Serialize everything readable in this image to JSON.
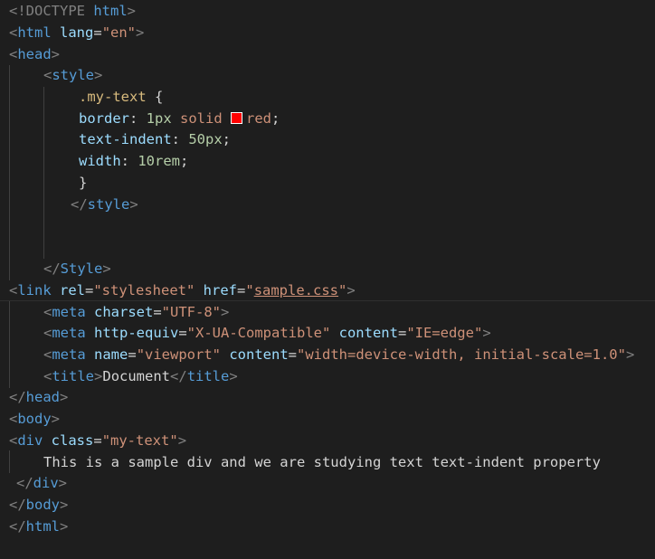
{
  "editor": {
    "theme_background": "#1e1e1e",
    "lines": {
      "l1": {
        "doctype_open": "<!DOCTYPE",
        "doctype_word": " html",
        "close": ">"
      },
      "l2": {
        "open": "<",
        "tag": "html",
        "attr": " lang",
        "eq": "=",
        "val": "\"en\"",
        "close": ">"
      },
      "l3": {
        "open": "<",
        "tag": "head",
        "close": ">"
      },
      "l4": {
        "open": "<",
        "tag": "style",
        "close": ">"
      },
      "l5": {
        "selector": ".my-text",
        "brace": " {"
      },
      "l6": {
        "prop": "border",
        "colon": ": ",
        "num": "1px",
        "val1": " solid ",
        "color": "red",
        "semi": ";",
        "swatch_color": "#ff0000"
      },
      "l7": {
        "prop": "text-indent",
        "colon": ": ",
        "num": "50px",
        "semi": ";"
      },
      "l8": {
        "prop": "width",
        "colon": ": ",
        "num": "10rem",
        "semi": ";"
      },
      "l9": {
        "brace": "}"
      },
      "l10": {
        "open": "</",
        "tag": "style",
        "close": ">"
      },
      "l13": {
        "open": "</",
        "tag": "Style",
        "close": ">"
      },
      "l14": {
        "open": "<",
        "tag": "link",
        "attr1": " rel",
        "eq": "=",
        "val1": "\"stylesheet\"",
        "attr2": " href",
        "val2_q1": "\"",
        "val2_url": "sample.css",
        "val2_q2": "\"",
        "close": ">"
      },
      "l15": {
        "open": "<",
        "tag": "meta",
        "attr": " charset",
        "eq": "=",
        "val": "\"UTF-8\"",
        "close": ">"
      },
      "l16": {
        "open": "<",
        "tag": "meta",
        "attr1": " http-equiv",
        "eq": "=",
        "val1": "\"X-UA-Compatible\"",
        "attr2": " content",
        "val2": "\"IE=edge\"",
        "close": ">"
      },
      "l17": {
        "open": "<",
        "tag": "meta",
        "attr1": " name",
        "eq": "=",
        "val1": "\"viewport\"",
        "attr2": " content",
        "val2": "\"width=device-width, initial-scale=1.0\"",
        "close": ">"
      },
      "l18": {
        "open": "<",
        "tag": "title",
        "close": ">",
        "text": "Document",
        "open2": "</",
        "tag2": "title",
        "close2": ">"
      },
      "l19": {
        "open": "</",
        "tag": "head",
        "close": ">"
      },
      "l20": {
        "open": "<",
        "tag": "body",
        "close": ">"
      },
      "l21": {
        "open": "<",
        "tag": "div",
        "attr": " class",
        "eq": "=",
        "val": "\"my-text\"",
        "close": ">"
      },
      "l22": {
        "text": "This is a sample div and we are studying text text-indent property"
      },
      "l23": {
        "open": "</",
        "tag": "div",
        "close": ">"
      },
      "l24": {
        "open": "</",
        "tag": "body",
        "close": ">"
      },
      "l25": {
        "open": "</",
        "tag": "html",
        "close": ">"
      }
    }
  }
}
